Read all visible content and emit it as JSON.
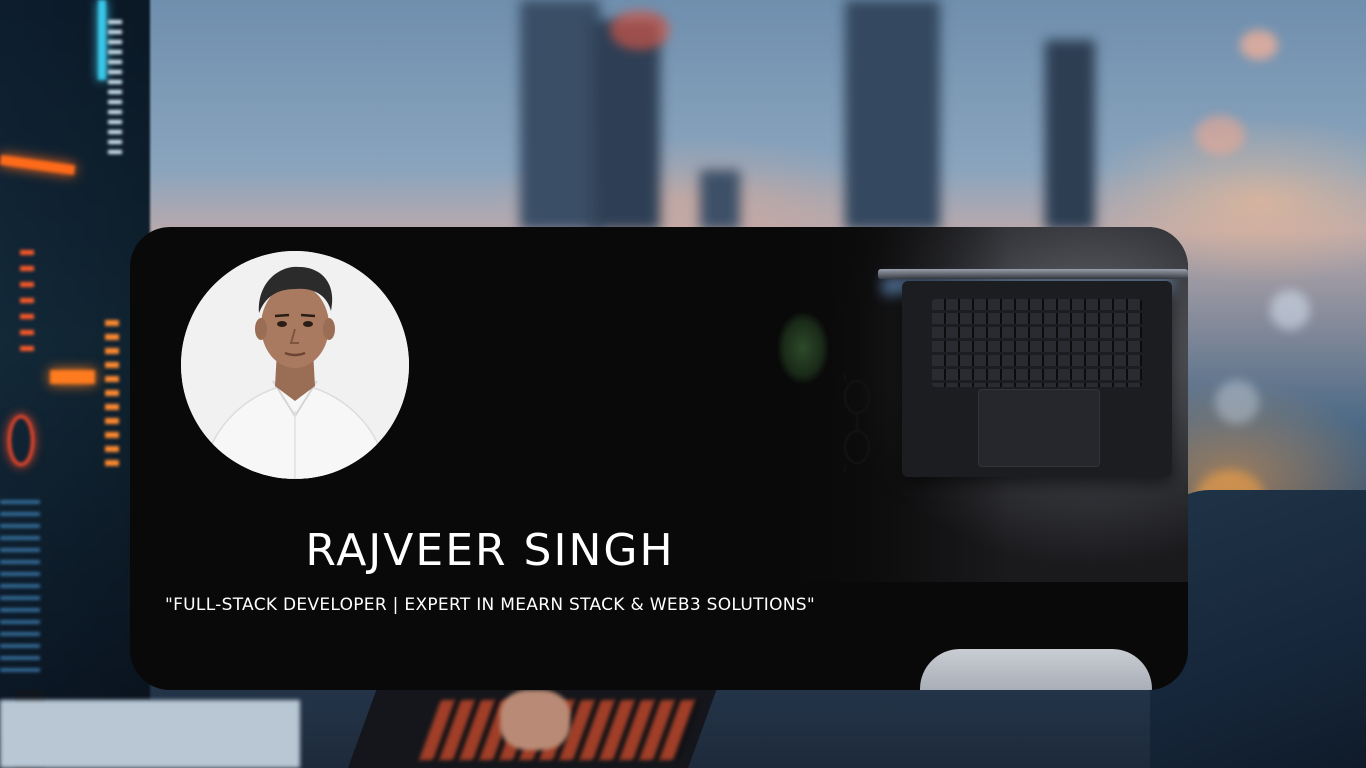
{
  "profile": {
    "name": "RAJVEER SINGH",
    "tagline": "\"FULL-STACK DEVELOPER | EXPERT IN MEARN STACK & WEB3 SOLUTIONS\""
  },
  "colors": {
    "card_background": "#090909",
    "text": "#ffffff",
    "avatar_background": "#f2f2f2"
  },
  "imagery": {
    "background": "blurred-city-skyline-with-coding-monitor",
    "card_photo": "laptop-glasses-on-desk",
    "avatar": "profile-photo-white-shirt"
  }
}
